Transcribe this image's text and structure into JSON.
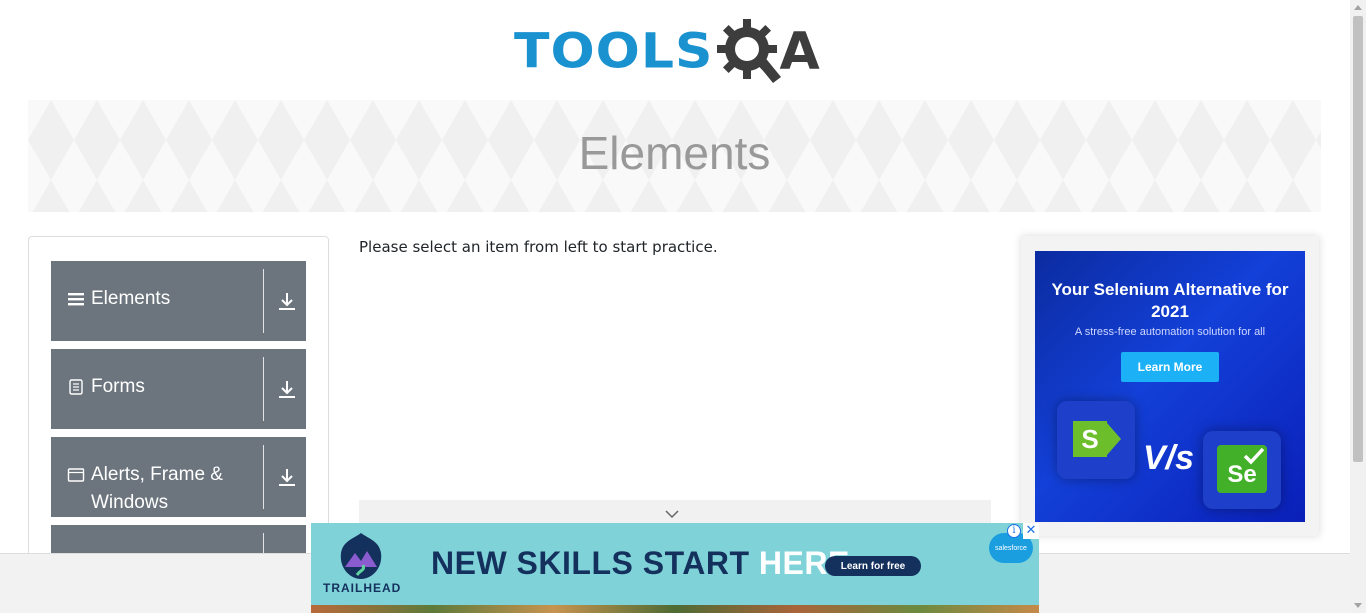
{
  "header": {
    "logo_part1": "TOOLS",
    "logo_part2": "A",
    "logo_icon": "gear-magnifier-q-icon"
  },
  "banner": {
    "title": "Elements"
  },
  "sidebar": {
    "groups": [
      {
        "label": "Elements",
        "icon": "hamburger-icon"
      },
      {
        "label": "Forms",
        "icon": "document-icon"
      },
      {
        "label": "Alerts, Frame & Windows",
        "icon": "browser-window-icon"
      },
      {
        "label": "",
        "icon": ""
      }
    ]
  },
  "main": {
    "message": "Please select an item from left to start practice."
  },
  "right_ad": {
    "headline": "Your Selenium Alternative for 2021",
    "subtext": "A stress-free automation solution for all",
    "button": "Learn More",
    "vs": "V/s",
    "left_logo": "S",
    "right_logo": "Se"
  },
  "bottom_ad": {
    "headline_part1": "NEW SKILLS START ",
    "headline_part2": "HERE.",
    "button": "Learn for free",
    "brand": "TRAILHEAD",
    "sponsor": "salesforce",
    "close": "✕",
    "info": "i"
  },
  "colors": {
    "brand_blue": "#1b92d0",
    "brand_dark": "#3d3d3d",
    "sidebar_group_bg": "#6c757d",
    "ad_button": "#1cb0f6",
    "bottom_ad_bg": "#7fd3d8"
  }
}
